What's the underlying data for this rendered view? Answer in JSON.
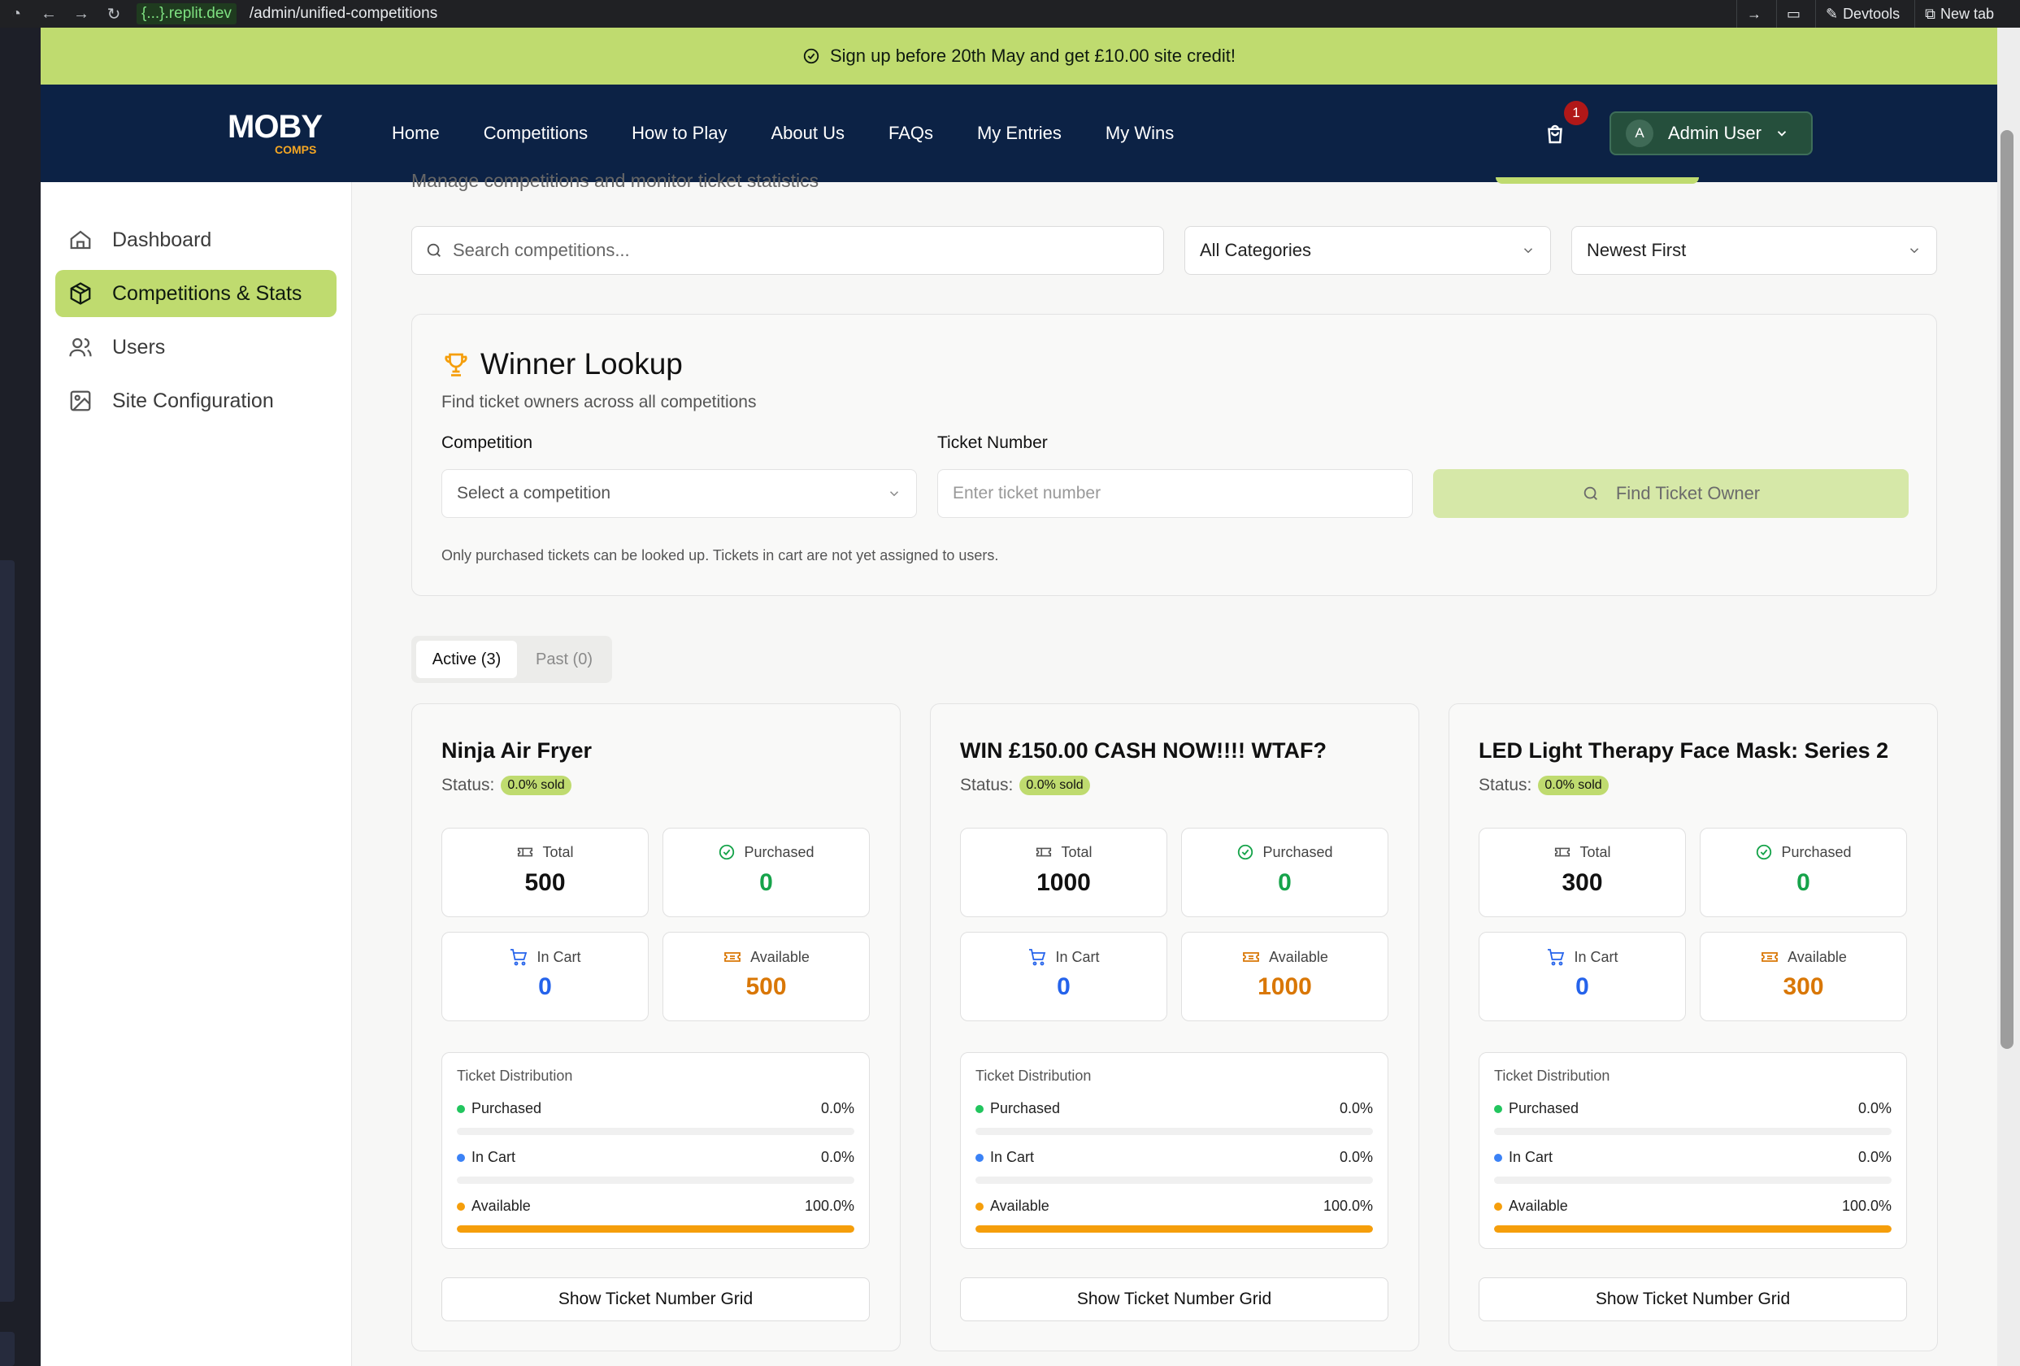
{
  "browser": {
    "host": "{...}.replit.dev",
    "path": "/admin/unified-competitions",
    "devtools_label": "Devtools",
    "new_tab_label": "New tab"
  },
  "banner": {
    "text": "Sign up before 20th May and get £10.00 site credit!"
  },
  "nav": {
    "logo_main": "MOBY",
    "logo_sub": "COMPS",
    "links": [
      "Home",
      "Competitions",
      "How to Play",
      "About Us",
      "FAQs",
      "My Entries",
      "My Wins"
    ],
    "cart_count": "1",
    "user_initial": "A",
    "user_name": "Admin User"
  },
  "sidebar": {
    "items": [
      {
        "label": "Dashboard",
        "icon": "home-icon"
      },
      {
        "label": "Competitions & Stats",
        "icon": "package-icon",
        "active": true
      },
      {
        "label": "Users",
        "icon": "users-icon"
      },
      {
        "label": "Site Configuration",
        "icon": "image-icon"
      }
    ]
  },
  "main": {
    "subtitle": "Manage competitions and monitor ticket statistics",
    "search_placeholder": "Search competitions...",
    "category_filter": "All Categories",
    "sort_filter": "Newest First"
  },
  "winner_lookup": {
    "title": "Winner Lookup",
    "description": "Find ticket owners across all competitions",
    "competition_label": "Competition",
    "competition_placeholder": "Select a competition",
    "ticket_label": "Ticket Number",
    "ticket_placeholder": "Enter ticket number",
    "find_button": "Find Ticket Owner",
    "note": "Only purchased tickets can be looked up. Tickets in cart are not yet assigned to users."
  },
  "tabs": {
    "active": "Active (3)",
    "past": "Past (0)"
  },
  "labels": {
    "status": "Status:",
    "total": "Total",
    "purchased": "Purchased",
    "in_cart": "In Cart",
    "available": "Available",
    "distribution": "Ticket Distribution",
    "grid_button": "Show Ticket Number Grid"
  },
  "colors": {
    "brand_green": "#bfdb6f",
    "navy": "#0c2245",
    "purchased": "#22c55e",
    "in_cart": "#3b82f6",
    "available": "#f59e0b"
  },
  "competitions": [
    {
      "title": "Ninja Air Fryer",
      "sold_badge": "0.0% sold",
      "total": "500",
      "purchased": "0",
      "in_cart": "0",
      "available": "500",
      "pct_purchased": "0.0%",
      "pct_in_cart": "0.0%",
      "pct_available": "100.0%",
      "fill_purchased": 0,
      "fill_in_cart": 0,
      "fill_available": 100
    },
    {
      "title": "WIN £150.00 CASH NOW!!!! WTAF?",
      "sold_badge": "0.0% sold",
      "total": "1000",
      "purchased": "0",
      "in_cart": "0",
      "available": "1000",
      "pct_purchased": "0.0%",
      "pct_in_cart": "0.0%",
      "pct_available": "100.0%",
      "fill_purchased": 0,
      "fill_in_cart": 0,
      "fill_available": 100
    },
    {
      "title": "LED Light Therapy Face Mask: Series 2",
      "sold_badge": "0.0% sold",
      "total": "300",
      "purchased": "0",
      "in_cart": "0",
      "available": "300",
      "pct_purchased": "0.0%",
      "pct_in_cart": "0.0%",
      "pct_available": "100.0%",
      "fill_purchased": 0,
      "fill_in_cart": 0,
      "fill_available": 100
    }
  ]
}
